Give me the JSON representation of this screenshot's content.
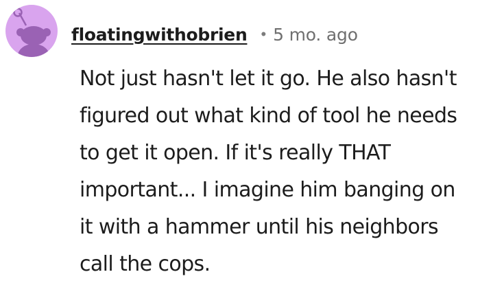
{
  "comment": {
    "username": "floatingwithobrien",
    "separator": "•",
    "timestamp": "5 mo. ago",
    "body": "Not just hasn't let it go. He also hasn't figured out what kind of tool he needs to get it open. If it's really THAT important... I imagine him banging on it with a hammer until his neighbors call the cops."
  },
  "colors": {
    "avatar_bg": "#d9a4ee",
    "avatar_figure": "#9a62b4",
    "text": "#1c1c1c",
    "muted": "#6f6f6f"
  },
  "icons": {
    "avatar": "reddit-snoo-avatar-icon"
  }
}
